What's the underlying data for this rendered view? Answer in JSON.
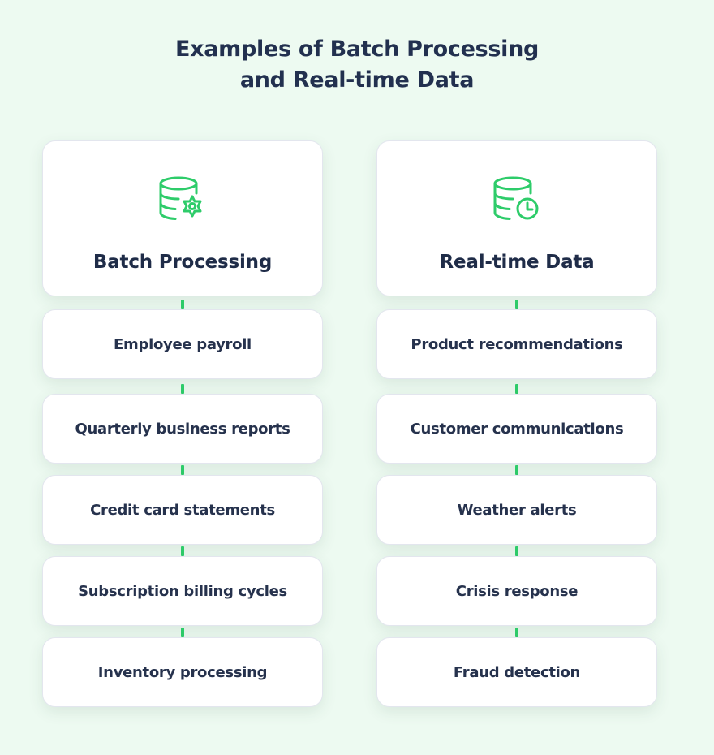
{
  "title": {
    "line1": "Examples of Batch Processing",
    "line2": "and Real-time Data"
  },
  "accent_color": "#2ecc6a",
  "columns": [
    {
      "heading": "Batch Processing",
      "icon": "database-gear-icon",
      "items": [
        "Employee payroll",
        "Quarterly business reports",
        "Credit card statements",
        "Subscription billing cycles",
        "Inventory processing"
      ]
    },
    {
      "heading": "Real-time Data",
      "icon": "database-clock-icon",
      "items": [
        "Product recommendations",
        "Customer communications",
        "Weather alerts",
        "Crisis response",
        "Fraud detection"
      ]
    }
  ]
}
